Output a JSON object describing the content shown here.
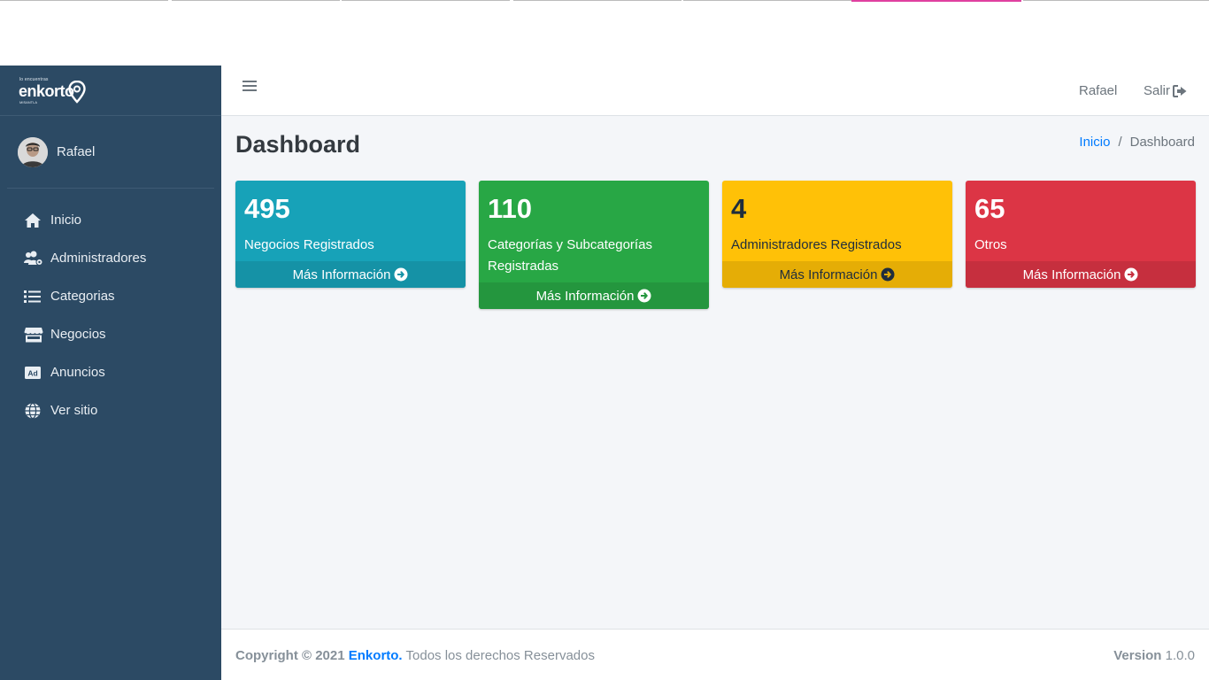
{
  "brand": {
    "tagline": "lo encuentras",
    "name": "enkorto",
    "subline": "MISANTLA"
  },
  "sidebar": {
    "user_name": "Rafael",
    "items": [
      {
        "label": "Inicio",
        "icon": "home-icon"
      },
      {
        "label": "Administradores",
        "icon": "users-cog-icon"
      },
      {
        "label": "Categorias",
        "icon": "list-icon"
      },
      {
        "label": "Negocios",
        "icon": "store-icon"
      },
      {
        "label": "Anuncios",
        "icon": "ad-icon"
      },
      {
        "label": "Ver sitio",
        "icon": "globe-icon"
      }
    ]
  },
  "topbar": {
    "user": "Rafael",
    "logout_label": "Salir"
  },
  "content": {
    "title": "Dashboard",
    "breadcrumb": {
      "home": "Inicio",
      "separator": "/",
      "current": "Dashboard"
    }
  },
  "stats": [
    {
      "value": "495",
      "label": "Negocios Registrados",
      "link": "Más Información",
      "color": "#17a2b8"
    },
    {
      "value": "110",
      "label": "Categorías y Subcategorías Registradas",
      "link": "Más Información",
      "color": "#28a745"
    },
    {
      "value": "4",
      "label": "Administradores Registrados",
      "link": "Más Información",
      "color": "#ffc107"
    },
    {
      "value": "65",
      "label": "Otros",
      "link": "Más Información",
      "color": "#dc3545"
    }
  ],
  "footer": {
    "copyright_prefix": "Copyright © 2021",
    "brand": "Enkorto.",
    "rights": "Todos los derechos Reservados",
    "version_label": "Version",
    "version_value": "1.0.0"
  },
  "colors": {
    "sidebar": "#2c4a64",
    "content_bg": "#f4f6f9",
    "link": "#007bff"
  }
}
